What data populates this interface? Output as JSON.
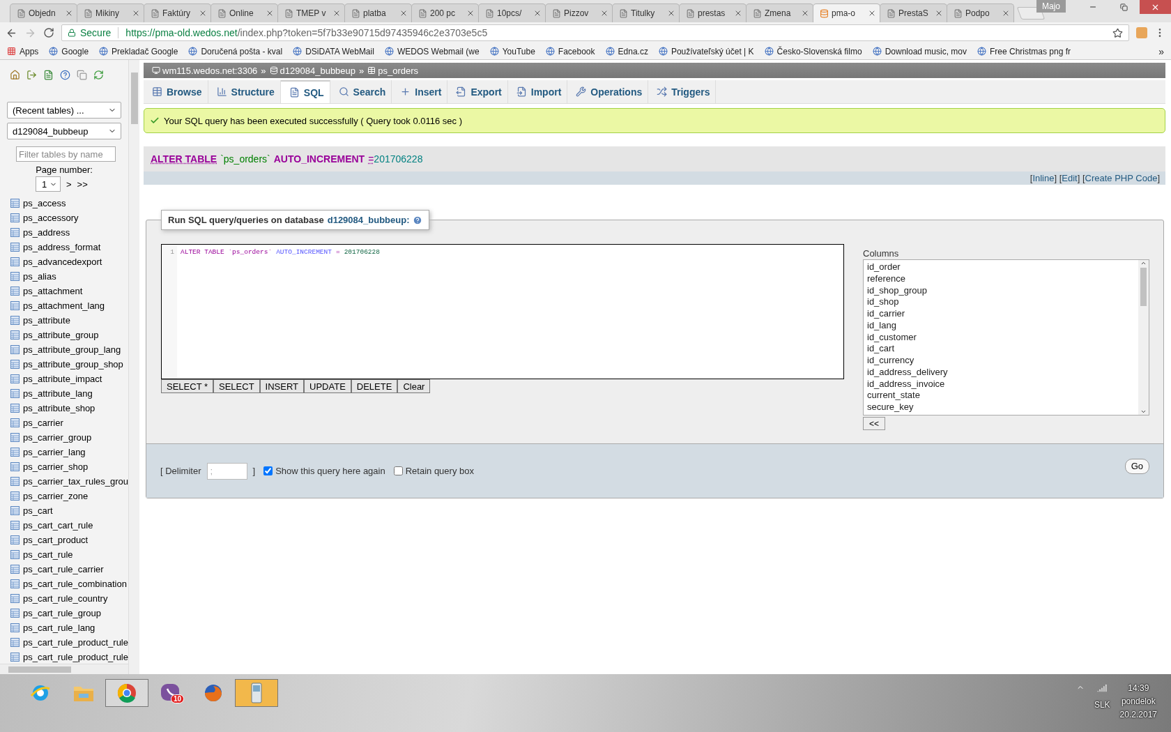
{
  "browser": {
    "tabs": [
      {
        "title": "Objedn",
        "selected": false
      },
      {
        "title": "Mikiny",
        "selected": false
      },
      {
        "title": "Faktúry",
        "selected": false
      },
      {
        "title": "Online",
        "selected": false
      },
      {
        "title": "TMEP v",
        "selected": false
      },
      {
        "title": "platba",
        "selected": false
      },
      {
        "title": "200 pc",
        "selected": false
      },
      {
        "title": "10pcs/",
        "selected": false
      },
      {
        "title": "Pizzov",
        "selected": false
      },
      {
        "title": "Titulky",
        "selected": false
      },
      {
        "title": "prestas",
        "selected": false
      },
      {
        "title": "Zmena",
        "selected": false
      },
      {
        "title": "pma-o",
        "selected": true
      },
      {
        "title": "PrestaS",
        "selected": false
      },
      {
        "title": "Podpo",
        "selected": false
      }
    ],
    "profile": "Majo",
    "secure_label": "Secure",
    "url_host": "https://pma-old.wedos.net",
    "url_path": "/index.php?token=5f7b33e90715d97435946c2e3703e5c5",
    "bookmarks": [
      {
        "title": "Apps",
        "kind": "apps"
      },
      {
        "title": "Google",
        "kind": "site"
      },
      {
        "title": "Prekladač Google",
        "kind": "site"
      },
      {
        "title": "Doručená pošta - kval",
        "kind": "site"
      },
      {
        "title": "DSiDATA WebMail",
        "kind": "site"
      },
      {
        "title": "WEDOS Webmail (we",
        "kind": "site"
      },
      {
        "title": "YouTube",
        "kind": "site"
      },
      {
        "title": "Facebook",
        "kind": "site"
      },
      {
        "title": "Edna.cz",
        "kind": "site"
      },
      {
        "title": "Používateľský účet | K",
        "kind": "site"
      },
      {
        "title": "Česko-Slovenská filmo",
        "kind": "site"
      },
      {
        "title": "Download music, mov",
        "kind": "site"
      },
      {
        "title": "Free Christmas png fr",
        "kind": "site"
      }
    ],
    "bookmarks_more": "»"
  },
  "sidebar": {
    "recent": "(Recent tables) ...",
    "database": "d129084_bubbeup",
    "filter_placeholder": "Filter tables by name",
    "page_label": "Page number:",
    "page": "1",
    "next": ">",
    "last": ">>",
    "tables": [
      "ps_access",
      "ps_accessory",
      "ps_address",
      "ps_address_format",
      "ps_advancedexport",
      "ps_alias",
      "ps_attachment",
      "ps_attachment_lang",
      "ps_attribute",
      "ps_attribute_group",
      "ps_attribute_group_lang",
      "ps_attribute_group_shop",
      "ps_attribute_impact",
      "ps_attribute_lang",
      "ps_attribute_shop",
      "ps_carrier",
      "ps_carrier_group",
      "ps_carrier_lang",
      "ps_carrier_shop",
      "ps_carrier_tax_rules_grou",
      "ps_carrier_zone",
      "ps_cart",
      "ps_cart_cart_rule",
      "ps_cart_product",
      "ps_cart_rule",
      "ps_cart_rule_carrier",
      "ps_cart_rule_combination",
      "ps_cart_rule_country",
      "ps_cart_rule_group",
      "ps_cart_rule_lang",
      "ps_cart_rule_product_rule",
      "ps_cart_rule_product_rule"
    ]
  },
  "breadcrumb": [
    {
      "text": "wm115.wedos.net:3306",
      "kind": "server"
    },
    {
      "text": "»",
      "kind": "separator"
    },
    {
      "text": "d129084_bubbeup",
      "kind": "database"
    },
    {
      "text": "»",
      "kind": "separator"
    },
    {
      "text": "ps_orders",
      "kind": "table"
    }
  ],
  "tabs": [
    {
      "label": "Browse",
      "selected": false
    },
    {
      "label": "Structure",
      "selected": false
    },
    {
      "label": "SQL",
      "selected": true
    },
    {
      "label": "Search",
      "selected": false
    },
    {
      "label": "Insert",
      "selected": false
    },
    {
      "label": "Export",
      "selected": false
    },
    {
      "label": "Import",
      "selected": false
    },
    {
      "label": "Operations",
      "selected": false
    },
    {
      "label": "Triggers",
      "selected": false
    }
  ],
  "message": "Your SQL query has been executed successfully ( Query took 0.0116 sec )",
  "query": [
    {
      "text": "ALTER TABLE",
      "kind": "keyword",
      "link": true
    },
    {
      "text": "`ps_orders`",
      "kind": "identifier",
      "link": false
    },
    {
      "text": "AUTO_INCREMENT",
      "kind": "keyword",
      "link": false
    },
    {
      "text": "=",
      "kind": "operator",
      "link": true
    },
    {
      "text": "201706228",
      "kind": "number",
      "link": false
    }
  ],
  "query_links": [
    {
      "text": "[",
      "kind": "plain"
    },
    {
      "text": "Inline",
      "kind": "link"
    },
    {
      "text": "] [",
      "kind": "plain"
    },
    {
      "text": "Edit",
      "kind": "link"
    },
    {
      "text": "] [",
      "kind": "plain"
    },
    {
      "text": "Create PHP Code",
      "kind": "link"
    },
    {
      "text": "]",
      "kind": "plain"
    }
  ],
  "sql_box": {
    "legend": "Run SQL query/queries on database",
    "database": "d129084_bubbeup:",
    "line_numbers": [
      "1"
    ],
    "editor": [
      {
        "text": "ALTER TABLE `ps_orders`",
        "kind": "keyword"
      },
      {
        "text": "AUTO_INCREMENT",
        "kind": "builtin"
      },
      {
        "text": "=",
        "kind": "operator"
      },
      {
        "text": "201706228",
        "kind": "number"
      }
    ],
    "buttons": [
      "SELECT *",
      "SELECT",
      "INSERT",
      "UPDATE",
      "DELETE",
      "Clear"
    ],
    "columns_label": "Columns",
    "columns": [
      "id_order",
      "reference",
      "id_shop_group",
      "id_shop",
      "id_carrier",
      "id_lang",
      "id_customer",
      "id_cart",
      "id_currency",
      "id_address_delivery",
      "id_address_invoice",
      "current_state",
      "secure_key"
    ],
    "insert_button": "<<",
    "delimiter_open": "[ Delimiter",
    "delimiter_value": ";",
    "delimiter_close": "]",
    "options": [
      {
        "label": "Show this query here again",
        "checked": true
      },
      {
        "label": "Retain query box",
        "checked": false
      }
    ],
    "go": "Go"
  },
  "taskbar": {
    "apps": [
      {
        "kind": "browser-e",
        "open": false,
        "flashing": false
      },
      {
        "kind": "folder",
        "open": false,
        "flashing": false
      },
      {
        "kind": "browser-ring",
        "open": true,
        "flashing": false
      },
      {
        "kind": "chat",
        "open": false,
        "flashing": false,
        "badge": "10"
      },
      {
        "kind": "browser-fox",
        "open": false,
        "flashing": false
      },
      {
        "kind": "phone",
        "open": true,
        "flashing": true
      }
    ],
    "lang": "SLK",
    "time": "14:39",
    "day": "pondelok",
    "date": "20.2.2017"
  }
}
